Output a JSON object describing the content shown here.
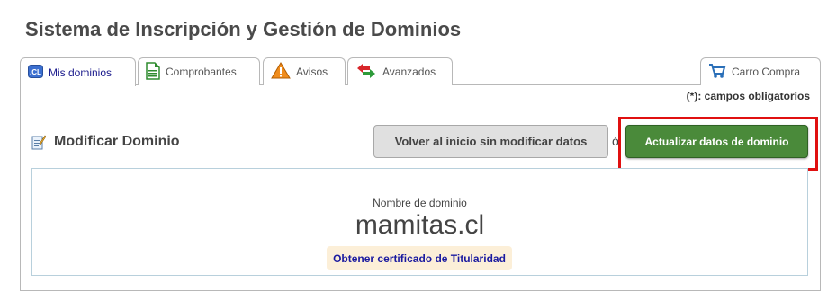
{
  "page": {
    "title": "Sistema de Inscripción y Gestión de Dominios"
  },
  "tabs": [
    {
      "label": "Mis dominios",
      "icon": "cl-domain-icon",
      "active": true
    },
    {
      "label": "Comprobantes",
      "icon": "document-icon"
    },
    {
      "label": "Avisos",
      "icon": "warning-icon"
    },
    {
      "label": "Avanzados",
      "icon": "transfer-arrows-icon"
    },
    {
      "label": "Carro Compra",
      "icon": "shopping-cart-icon"
    }
  ],
  "required_note": "(*): campos obligatorios",
  "section": {
    "title": "Modificar Dominio",
    "icon": "edit-document-icon"
  },
  "buttons": {
    "back": "Volver al inicio sin modificar datos",
    "update": "Actualizar datos de dominio"
  },
  "stray_char": "ó",
  "domain": {
    "label": "Nombre de dominio",
    "name": "mamitas.cl",
    "certificate_link": "Obtener certificado de Titularidad"
  },
  "colors": {
    "update_button": "#4a8a3a",
    "highlight": "#e01010",
    "link": "#1a1aa0"
  }
}
